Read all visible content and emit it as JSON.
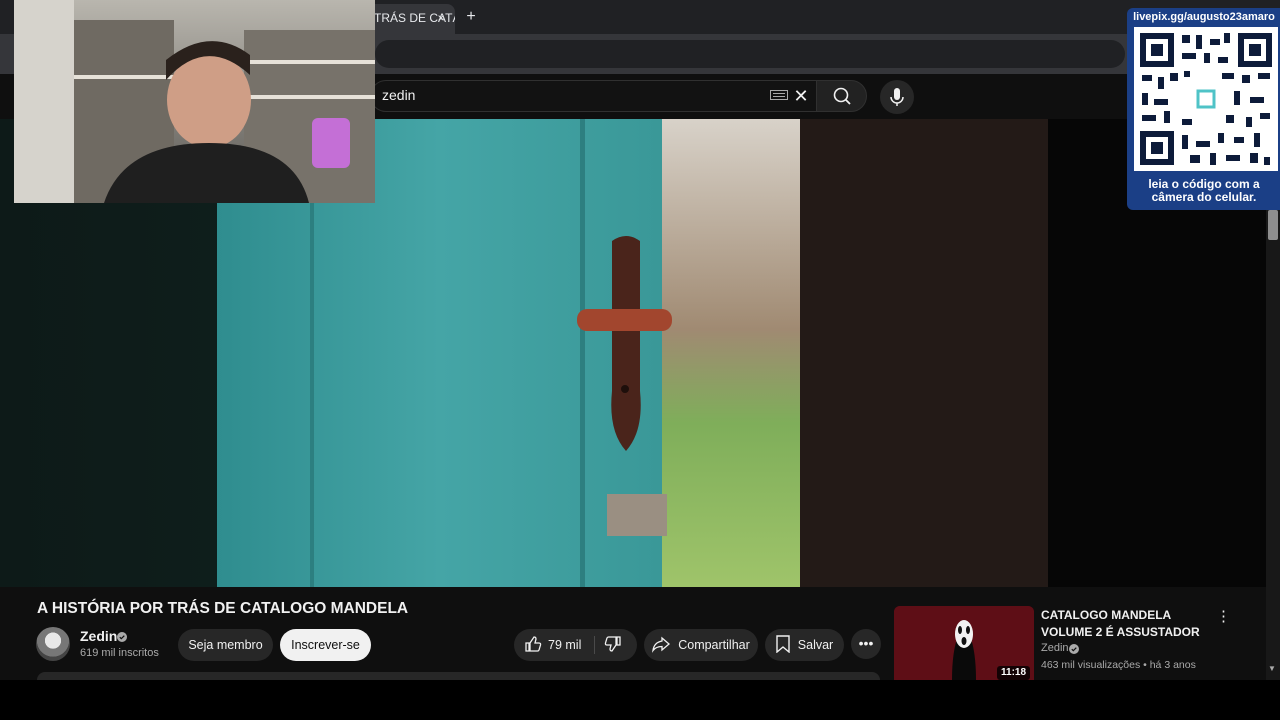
{
  "browser": {
    "tab_title": "TRÁS DE CATÁ",
    "tab_close": "×",
    "new_tab": "+"
  },
  "search": {
    "query": "zedin",
    "clear": "✕"
  },
  "overlay": {
    "qr_url": "livepix.gg/augusto23amaro",
    "qr_caption": "leia o código com a câmera do celular."
  },
  "video": {
    "title": "A HISTÓRIA POR TRÁS DE CATALOGO MANDELA",
    "channel": "Zedin",
    "subscribers": "619 mil inscritos",
    "join_label": "Seja membro",
    "subscribe_label": "Inscrever-se",
    "likes": "79 mil",
    "share_label": "Compartilhar",
    "save_label": "Salvar",
    "more": "•••"
  },
  "related": {
    "title": "CATALOGO MANDELA VOLUME 2 É ASSUSTADOR",
    "channel": "Zedin",
    "meta": "463 mil visualizações • há 3 anos",
    "duration": "11:18",
    "more": "⋮"
  },
  "colors": {
    "door": "#3f9a9a",
    "subscribe_bg": "#f1f1f1",
    "qr_panel": "#1b3f86"
  },
  "icons": [
    "keyboard-icon",
    "close-icon",
    "search-icon",
    "mic-icon",
    "like-icon",
    "dislike-icon",
    "share-icon",
    "save-icon",
    "verified-icon",
    "more-icon"
  ]
}
